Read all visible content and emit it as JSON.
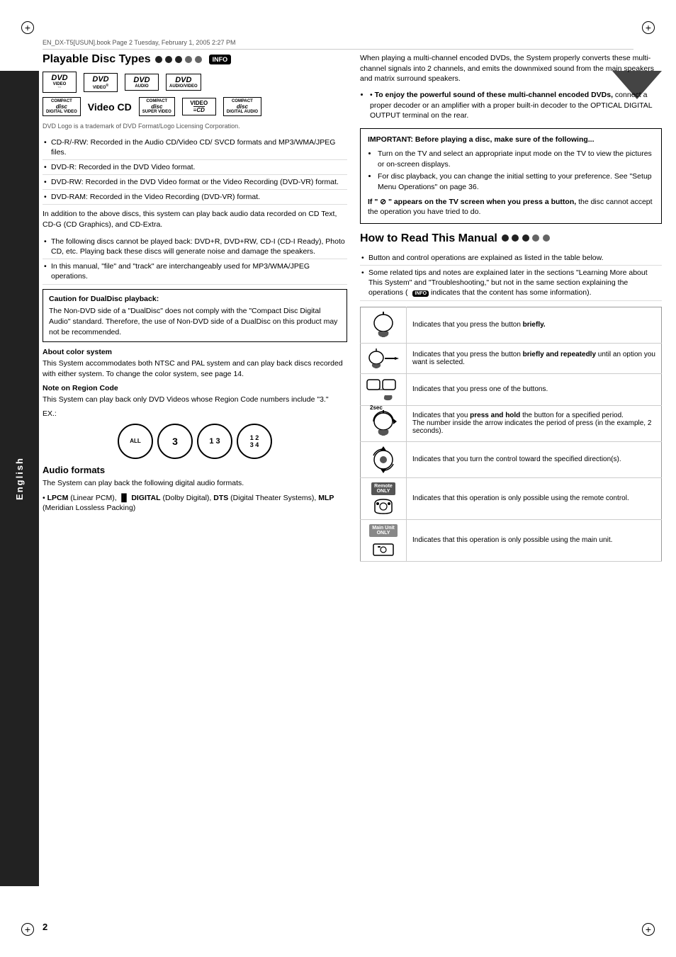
{
  "page": {
    "number": "2",
    "header_text": "EN_DX-T5[USUN].book  Page 2  Tuesday, February 1, 2005  2:27 PM"
  },
  "sidebar": {
    "label": "English"
  },
  "left_column": {
    "playable_disc": {
      "title": "Playable Disc Types",
      "info_badge": "INFO",
      "logo_note": "DVD Logo is a trademark of DVD Format/Logo Licensing Corporation.",
      "disc_types": [
        {
          "label": "• CD-R/-RW: Recorded in the Audio CD/Video CD/ SVCD formats and MP3/WMA/JPEG files."
        },
        {
          "label": "• DVD-R: Recorded in the DVD Video format."
        },
        {
          "label": "• DVD-RW: Recorded in the DVD Video format or the Video Recording (DVD-VR) format."
        },
        {
          "label": "• DVD-RAM: Recorded in the Video Recording (DVD-VR) format."
        }
      ],
      "para1": "In addition to the above discs, this system can play back audio data recorded on CD Text, CD-G (CD Graphics), and CD-Extra.",
      "cant_play_bullets": [
        "The following discs cannot be played back: DVD+R, DVD+RW, CD-I (CD-I Ready), Photo CD, etc. Playing back these discs will generate noise and damage the speakers.",
        "In this manual, \"file\" and \"track\" are interchangeably used for MP3/WMA/JPEG operations."
      ],
      "caution": {
        "title": "Caution for DualDisc playback:",
        "text": "The Non-DVD side of a \"DualDisc\" does not comply with the \"Compact Disc Digital Audio\" standard. Therefore, the use of Non-DVD side of a DualDisc on this product may not be recommended."
      },
      "color_system": {
        "title": "About color system",
        "text": "This System accommodates both NTSC and PAL system and can play back discs recorded with either system. To change the color system, see page 14."
      },
      "region_code": {
        "title": "Note on Region Code",
        "text": "This System can play back only DVD Videos whose Region Code numbers include \"3.\"",
        "ex_label": "EX.:"
      },
      "audio_formats": {
        "title": "Audio formats",
        "text1": "The System can play back the following digital audio formats.",
        "text2": "• LPCM (Linear PCM),  DIGITAL (Dolby Digital), DTS (Digital Theater Systems), MLP (Meridian Lossless Packing)"
      }
    }
  },
  "right_column": {
    "multichannel_text": "When playing a multi-channel encoded DVDs, the System properly converts these multi-channel signals into 2 channels, and emits the downmixed sound from the main speakers and matrix surround speakers.",
    "bullet_multichannel": "To enjoy the powerful sound of these multi-channel encoded DVDs, connect a proper decoder or an amplifier with a proper built-in decoder to the OPTICAL DIGITAL OUTPUT terminal on the rear.",
    "important_box": {
      "title": "IMPORTANT: Before playing a disc, make sure of the following...",
      "items": [
        "Turn on the TV and select an appropriate input mode on the TV to view the pictures or on-screen displays.",
        "For disc playback, you can change the initial setting to your preference. See \"Setup Menu Operations\" on page 36."
      ],
      "if_text": "If \" \" appears on the TV screen when you press a button, the disc cannot accept the operation you have tried to do."
    },
    "how_to_read": {
      "title": "How to Read This Manual",
      "intro_bullets": [
        "Button and control operations are explained as listed in the table below.",
        "Some related tips and notes are explained later in the sections \"Learning More about This System\" and \"Troubleshooting,\" but not in the same section explaining the operations (  indicates that the content has some information)."
      ],
      "table_rows": [
        {
          "icon_type": "press_brief",
          "description": "Indicates that you press the button briefly."
        },
        {
          "icon_type": "press_brief_repeat",
          "description": "Indicates that you press the button briefly and repeatedly until an option you want is selected."
        },
        {
          "icon_type": "press_buttons",
          "description": "Indicates that you press one of the buttons."
        },
        {
          "icon_type": "press_hold",
          "description": "Indicates that you press and hold the button for a specified period.\nThe number inside the arrow indicates the period of press (in the example, 2 seconds)."
        },
        {
          "icon_type": "turn_control",
          "description": "Indicates that you turn the control toward the specified direction(s)."
        },
        {
          "icon_type": "remote_only",
          "description": "Indicates that this operation is only possible using the remote control."
        },
        {
          "icon_type": "main_only",
          "description": "Indicates that this operation is only possible using the main unit."
        }
      ]
    }
  }
}
